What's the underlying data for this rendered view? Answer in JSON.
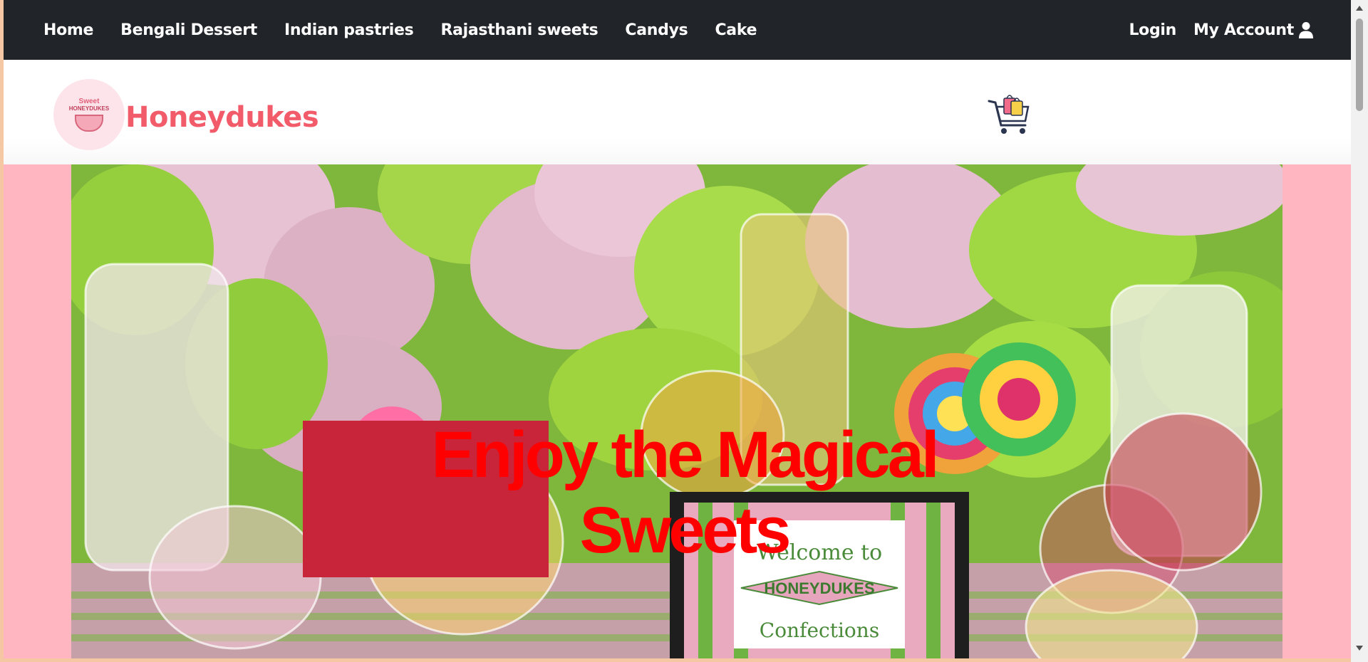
{
  "nav": {
    "items": [
      {
        "label": "Home"
      },
      {
        "label": "Bengali Dessert"
      },
      {
        "label": "Indian pastries"
      },
      {
        "label": "Rajasthani sweets"
      },
      {
        "label": "Candys"
      },
      {
        "label": "Cake"
      }
    ],
    "login": "Login",
    "account": "My Account",
    "account_icon": "user-icon"
  },
  "header": {
    "brand": "Honeydukes",
    "logo_text": [
      "Sweet",
      "HONEYDUKES"
    ],
    "cart_icon": "shopping-cart-icon"
  },
  "hero": {
    "headline": "Enjoy the Magical Sweets",
    "image_sign_lines": [
      "Welcome to",
      "HONEYDUKES",
      "Confections"
    ]
  },
  "colors": {
    "nav_bg": "#212529",
    "page_bg": "#ffb6c1",
    "brand": "#f25c6a",
    "headline": "#ff0000"
  }
}
